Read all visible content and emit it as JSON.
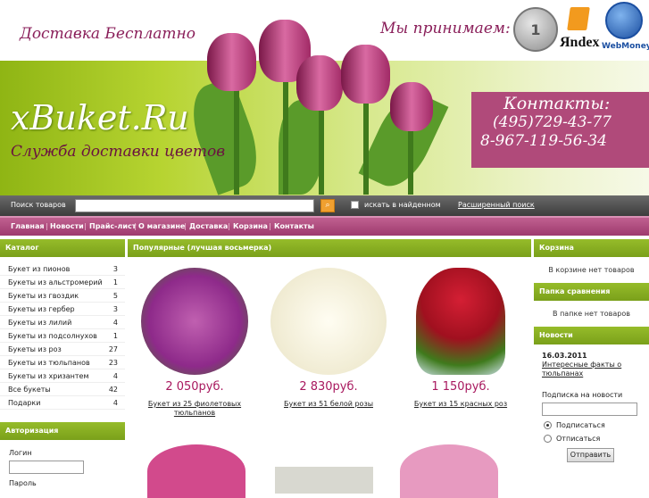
{
  "header": {
    "delivery": "Доставка Бесплатно",
    "accept": "Мы принимаем:",
    "coin_label": "1",
    "yandex": "Яndex",
    "webmoney": "WebMoney"
  },
  "banner": {
    "logo": "xBuket.Ru",
    "slogan": "Служба доставки цветов",
    "contacts_title": "Контакты:",
    "phone1": "(495)729-43-77",
    "phone2": "8-967-119-56-34"
  },
  "search": {
    "label": "Поиск товаров",
    "value": "",
    "go_icon": "search-icon",
    "in_found": "искать в найденном",
    "advanced": "Расширенный поиск"
  },
  "nav": {
    "items": [
      "Главная",
      "Новости",
      "Прайс-лист",
      "О магазине",
      "Доставка",
      "Корзина",
      "Контакты"
    ]
  },
  "catalog": {
    "title": "Каталог",
    "items": [
      {
        "label": "Букет из пионов",
        "count": "3"
      },
      {
        "label": "Букеты из альстромерий",
        "count": "1"
      },
      {
        "label": "Букеты из гвоздик",
        "count": "5"
      },
      {
        "label": "Букеты из гербер",
        "count": "3"
      },
      {
        "label": "Букеты из лилий",
        "count": "4"
      },
      {
        "label": "Букеты из подсолнухов",
        "count": "1"
      },
      {
        "label": "Букеты из роз",
        "count": "27"
      },
      {
        "label": "Букеты из тюльпанов",
        "count": "23"
      },
      {
        "label": "Букеты из хризантем",
        "count": "4"
      },
      {
        "label": "Все букеты",
        "count": "42"
      },
      {
        "label": "Подарки",
        "count": "4"
      }
    ]
  },
  "auth": {
    "title": "Авторизация",
    "login": "Логин",
    "password": "Пароль"
  },
  "popular": {
    "title": "Популярные (лучшая восьмерка)",
    "products": [
      {
        "price": "2 050руб.",
        "name": "Букет из 25 фиолетовых тюльпанов",
        "color": "#8e2a8a"
      },
      {
        "price": "2 830руб.",
        "name": "Букет из 51 белой розы",
        "color": "#f3efd9"
      },
      {
        "price": "1 150руб.",
        "name": "Букет из 15 красных роз",
        "color": "#c0142a"
      }
    ]
  },
  "cart": {
    "title": "Корзина",
    "text": "В корзине нет товаров"
  },
  "compare": {
    "title": "Папка сравнения",
    "text": "В папке нет товаров"
  },
  "news": {
    "title": "Новости",
    "date": "16.03.2011",
    "item": "Интересные факты о тюльпанах",
    "subscribe_label": "Подписка на новости",
    "subscribe": "Подписаться",
    "unsubscribe": "Отписаться",
    "send": "Отправить"
  }
}
